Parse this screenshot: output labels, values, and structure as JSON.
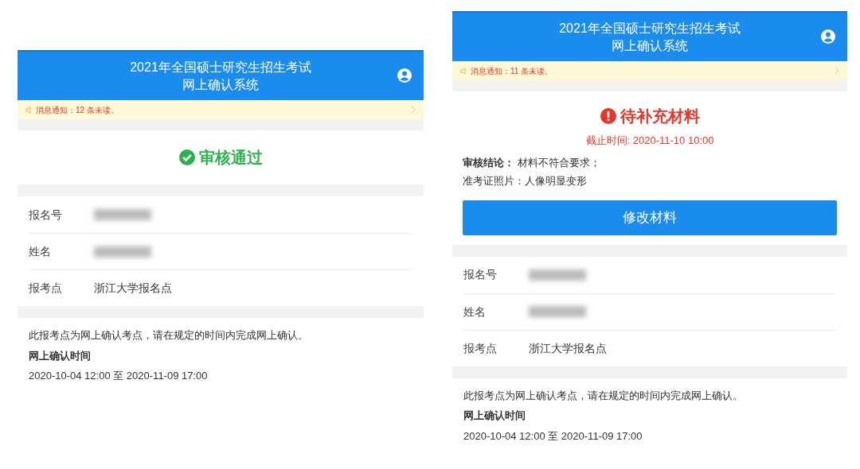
{
  "screens": [
    {
      "header": {
        "title_line_1": "2021年全国硕士研究生招生考试",
        "title_line_2": "网上确认系统"
      },
      "notice": "消息通知：12 条未读。",
      "status": {
        "kind": "approved",
        "label": "审核通过"
      },
      "fields": [
        {
          "label": "报名号",
          "redacted": true
        },
        {
          "label": "姓名",
          "redacted": true
        },
        {
          "label": "报考点",
          "value": "浙江大学报名点",
          "redacted": false
        }
      ],
      "info": {
        "text": "此报考点为网上确认考点，请在规定的时间内完成网上确认。",
        "heading": "网上确认时间",
        "period": "2020-10-04 12:00 至 2020-11-09 17:00"
      }
    },
    {
      "header": {
        "title_line_1": "2021年全国硕士研究生招生考试",
        "title_line_2": "网上确认系统"
      },
      "notice": "消息通知：11 条未读。",
      "status": {
        "kind": "needs_materials",
        "label": "待补充材料",
        "deadline": "截止时间: 2020-11-10 10:00",
        "review": [
          "**审核结论：** 材料不符合要求；",
          "准考证照片：人像明显变形"
        ],
        "button": "修改材料"
      },
      "fields": [
        {
          "label": "报名号",
          "redacted": true
        },
        {
          "label": "姓名",
          "redacted": true
        },
        {
          "label": "报考点",
          "value": "浙江大学报名点",
          "redacted": false
        }
      ],
      "info": {
        "text": "此报考点为网上确认考点，请在规定的时间内完成网上确认。",
        "heading": "网上确认时间",
        "period": "2020-10-04 12:00 至 2020-11-09 17:00"
      }
    }
  ]
}
